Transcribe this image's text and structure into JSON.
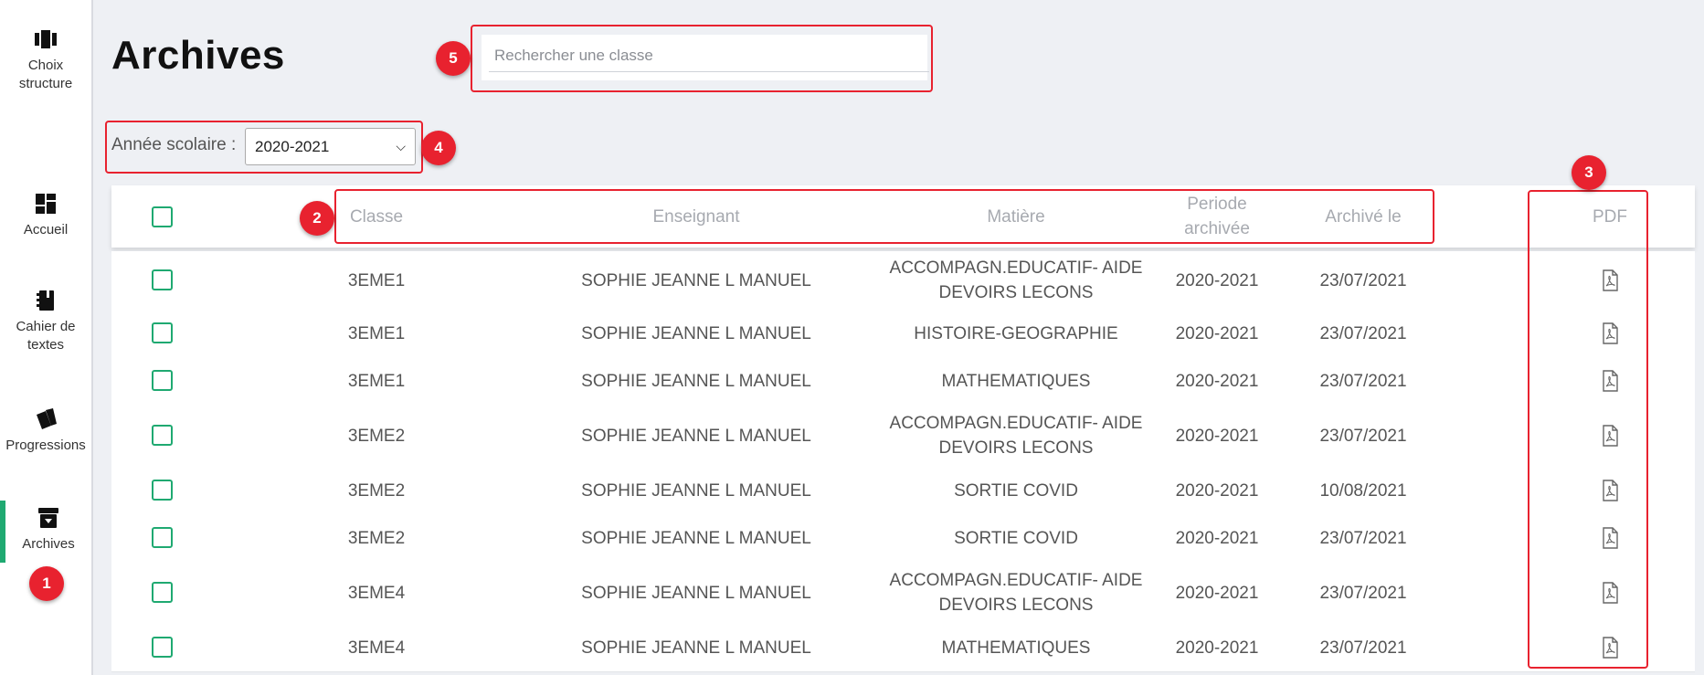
{
  "sidebar": {
    "items": [
      {
        "label": "Choix structure",
        "icon": "columns-icon",
        "active": false
      },
      {
        "label": "Accueil",
        "icon": "dashboard-icon",
        "active": false
      },
      {
        "label": "Cahier de textes",
        "icon": "notebook-icon",
        "active": false
      },
      {
        "label": "Progressions",
        "icon": "cards-icon",
        "active": false
      },
      {
        "label": "Archives",
        "icon": "archive-icon",
        "active": true
      }
    ]
  },
  "page": {
    "title": "Archives"
  },
  "search": {
    "placeholder": "Rechercher une classe",
    "value": ""
  },
  "filter": {
    "label": "Année scolaire :",
    "selected": "2020-2021"
  },
  "annotations": [
    "1",
    "2",
    "3",
    "4",
    "5"
  ],
  "accent_color": "#1fa971",
  "annotation_color": "#e8222f",
  "table": {
    "headers": {
      "classe": "Classe",
      "enseignant": "Enseignant",
      "matiere": "Matière",
      "periode": "Periode archivée",
      "archive_le": "Archivé le",
      "pdf": "PDF"
    },
    "rows": [
      {
        "classe": "3EME1",
        "enseignant": "SOPHIE JEANNE L MANUEL",
        "matiere": "ACCOMPAGN.EDUCATIF- AIDE DEVOIRS LECONS",
        "periode": "2020-2021",
        "date": "23/07/2021"
      },
      {
        "classe": "3EME1",
        "enseignant": "SOPHIE JEANNE L MANUEL",
        "matiere": "HISTOIRE-GEOGRAPHIE",
        "periode": "2020-2021",
        "date": "23/07/2021"
      },
      {
        "classe": "3EME1",
        "enseignant": "SOPHIE JEANNE L MANUEL",
        "matiere": "MATHEMATIQUES",
        "periode": "2020-2021",
        "date": "23/07/2021"
      },
      {
        "classe": "3EME2",
        "enseignant": "SOPHIE JEANNE L MANUEL",
        "matiere": "ACCOMPAGN.EDUCATIF- AIDE DEVOIRS LECONS",
        "periode": "2020-2021",
        "date": "23/07/2021"
      },
      {
        "classe": "3EME2",
        "enseignant": "SOPHIE JEANNE L MANUEL",
        "matiere": "SORTIE COVID",
        "periode": "2020-2021",
        "date": "10/08/2021"
      },
      {
        "classe": "3EME2",
        "enseignant": "SOPHIE JEANNE L MANUEL",
        "matiere": "SORTIE COVID",
        "periode": "2020-2021",
        "date": "23/07/2021"
      },
      {
        "classe": "3EME4",
        "enseignant": "SOPHIE JEANNE L MANUEL",
        "matiere": "ACCOMPAGN.EDUCATIF- AIDE DEVOIRS LECONS",
        "periode": "2020-2021",
        "date": "23/07/2021"
      },
      {
        "classe": "3EME4",
        "enseignant": "SOPHIE JEANNE L MANUEL",
        "matiere": "MATHEMATIQUES",
        "periode": "2020-2021",
        "date": "23/07/2021"
      }
    ]
  }
}
